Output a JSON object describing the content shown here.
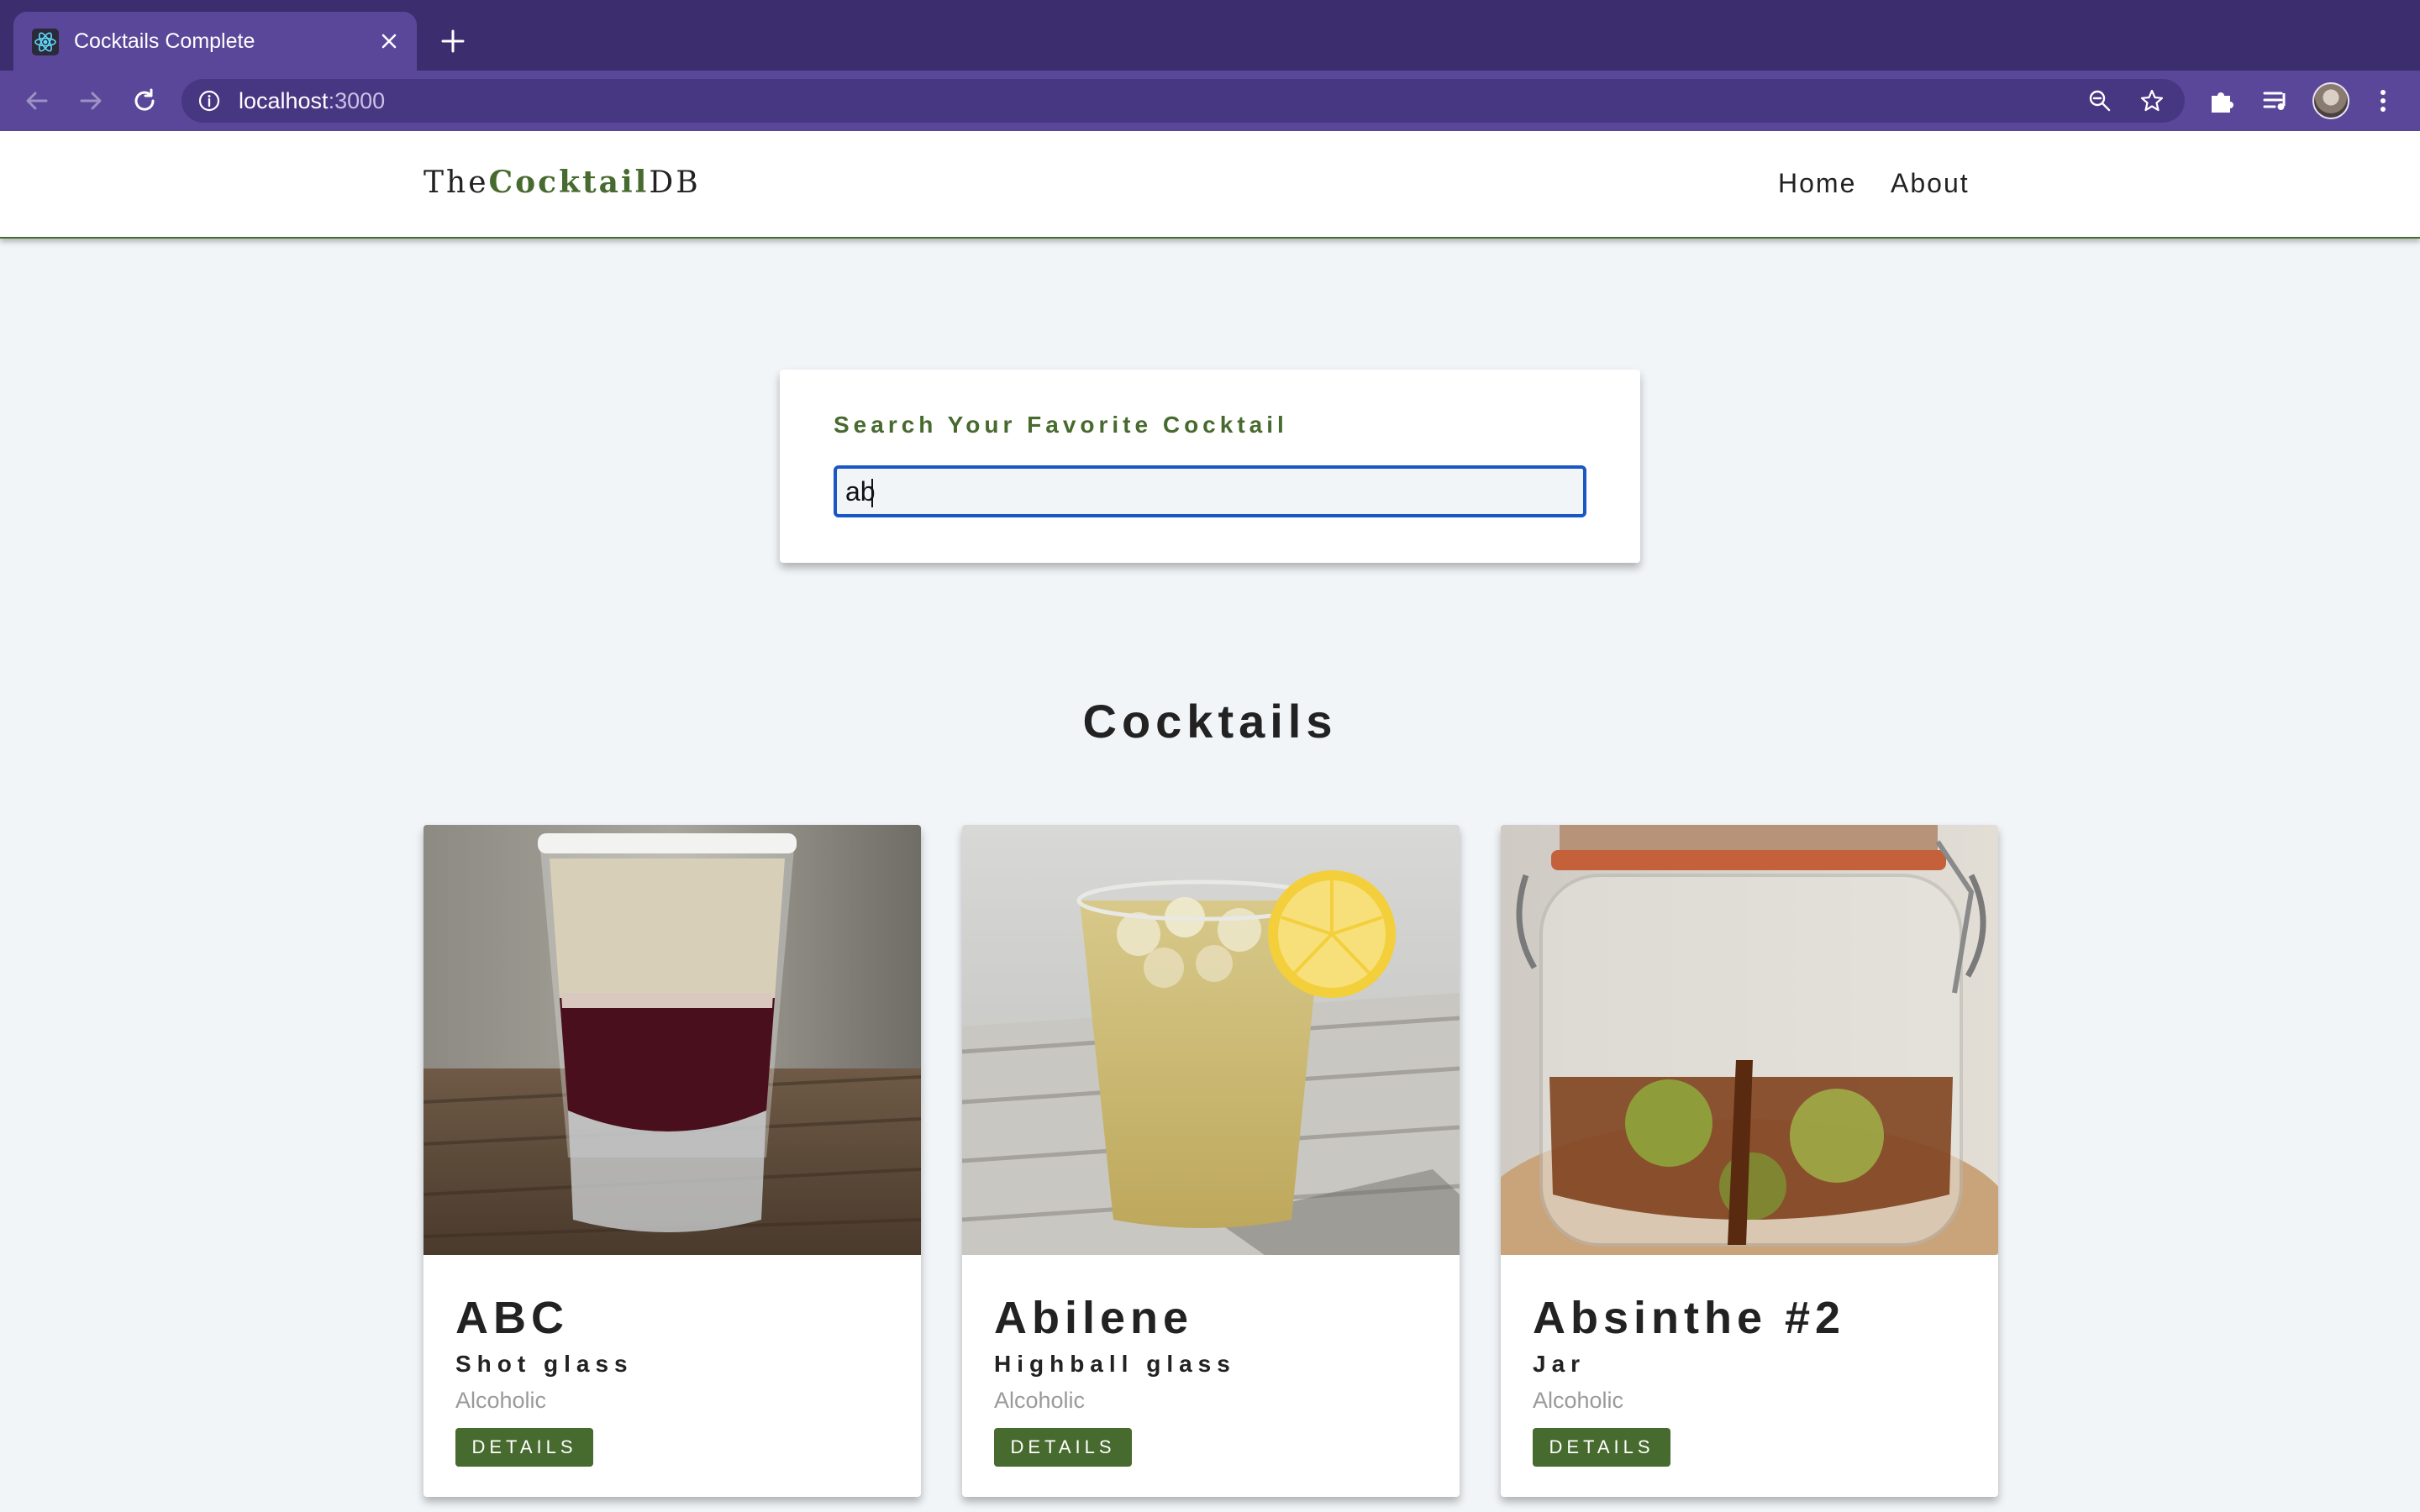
{
  "browser": {
    "tab_title": "Cocktails Complete",
    "url_host": "localhost",
    "url_port": ":3000"
  },
  "navbar": {
    "logo_prefix": "The",
    "logo_bold": "Cocktail",
    "logo_suffix": "DB",
    "links": [
      "Home",
      "About"
    ]
  },
  "search": {
    "label": "Search Your Favorite Cocktail",
    "value": "ab"
  },
  "section_title": "Cocktails",
  "cocktails": [
    {
      "name": "ABC",
      "glass": "Shot glass",
      "type": "Alcoholic",
      "button": "DETAILS"
    },
    {
      "name": "Abilene",
      "glass": "Highball glass",
      "type": "Alcoholic",
      "button": "DETAILS"
    },
    {
      "name": "Absinthe #2",
      "glass": "Jar",
      "type": "Alcoholic",
      "button": "DETAILS"
    }
  ],
  "colors": {
    "accent": "#476a2e",
    "browser_frame": "#3b2d6e",
    "browser_toolbar": "#5a479a",
    "page_bg": "#f1f5f8"
  },
  "icons": [
    "react-favicon-icon",
    "close-icon",
    "plus-icon",
    "back-arrow-icon",
    "forward-arrow-icon",
    "reload-icon",
    "info-icon",
    "zoom-icon",
    "star-icon",
    "puzzle-icon",
    "media-queue-icon",
    "avatar",
    "kebab-menu-icon"
  ]
}
